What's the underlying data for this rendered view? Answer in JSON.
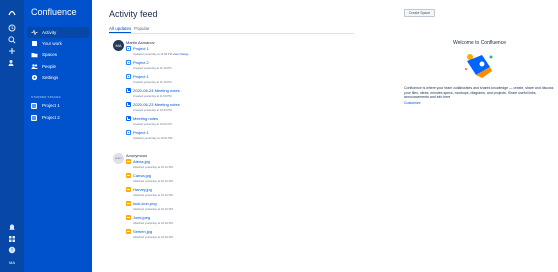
{
  "rail": {
    "icons": [
      "atlassian-switcher-icon",
      "recent-icon",
      "search-icon",
      "create-icon",
      "people-icon",
      "notifications-icon",
      "apps-icon",
      "help-icon"
    ],
    "profile_initials": "MA"
  },
  "sidebar": {
    "brand": "Confluence",
    "nav": [
      {
        "label": "Activity",
        "icon": "activity-icon",
        "active": true
      },
      {
        "label": "Your work",
        "icon": "your-work-icon",
        "active": false
      },
      {
        "label": "Spaces",
        "icon": "spaces-icon",
        "active": false
      },
      {
        "label": "People",
        "icon": "people-icon",
        "active": false
      },
      {
        "label": "Settings",
        "icon": "settings-icon",
        "active": false
      }
    ],
    "starred_heading": "STARRED SPACES",
    "starred": [
      {
        "label": "Project 1"
      },
      {
        "label": "Project 2"
      }
    ]
  },
  "main": {
    "title": "Activity feed",
    "tabs": [
      {
        "label": "All updates",
        "active": true
      },
      {
        "label": "Popular",
        "active": false
      }
    ],
    "create_space_label": "Create Space",
    "groups": [
      {
        "user": "Martin Asmanov",
        "avatar_initials": "MA",
        "items": [
          {
            "title": "Project 1",
            "meta": "Updated yesterday at 11:08 PM",
            "link": "view change",
            "type": "page"
          },
          {
            "title": "Project 2",
            "meta": "Created yesterday at 11:16 PM",
            "type": "page"
          },
          {
            "title": "Project 1",
            "meta": "Created yesterday at 11:16 PM",
            "type": "page"
          },
          {
            "title": "2020-06-24 Meeting notes",
            "meta": "Created yesterday at 11:00 PM",
            "type": "meeting"
          },
          {
            "title": "2020-06-23 Meeting notes",
            "meta": "Created yesterday at 10:20 PM",
            "type": "meeting"
          },
          {
            "title": "Meeting notes",
            "meta": "Created yesterday at 10:02 PM",
            "type": "page"
          },
          {
            "title": "Project 1",
            "meta": "Updated yesterday at 10:01 PM",
            "type": "page"
          }
        ]
      },
      {
        "user": "Anonymous",
        "avatar_initials": "anon",
        "items": [
          {
            "title": "Atena.jpg",
            "meta": "Attached yesterday at 10:14 PM",
            "type": "image"
          },
          {
            "title": "Canva.jpg",
            "meta": "Attached yesterday at 10:14 PM",
            "type": "image"
          },
          {
            "title": "Harvey.jpg",
            "meta": "Attached yesterday at 10:14 PM",
            "type": "image"
          },
          {
            "title": "lock-icon.png",
            "meta": "Attached yesterday at 10:10 PM",
            "type": "image"
          },
          {
            "title": "Joek.jpeg",
            "meta": "Attached yesterday at 10:04 PM",
            "type": "image"
          },
          {
            "title": "Semen.jpg",
            "meta": "Attached yesterday at 10:04 PM",
            "type": "image"
          }
        ]
      }
    ]
  },
  "welcome": {
    "title": "Welcome to Confluence",
    "text": "Confluence is where your team collaborates and shares knowledge — create, share and discuss your files, ideas, minutes specs, mockups, diagrams, and projects. Share useful links, announcements and info here",
    "customize_label": "Customize"
  },
  "colors": {
    "rail": "#0747a6",
    "sidebar": "#0052cc",
    "link": "#0052cc"
  }
}
